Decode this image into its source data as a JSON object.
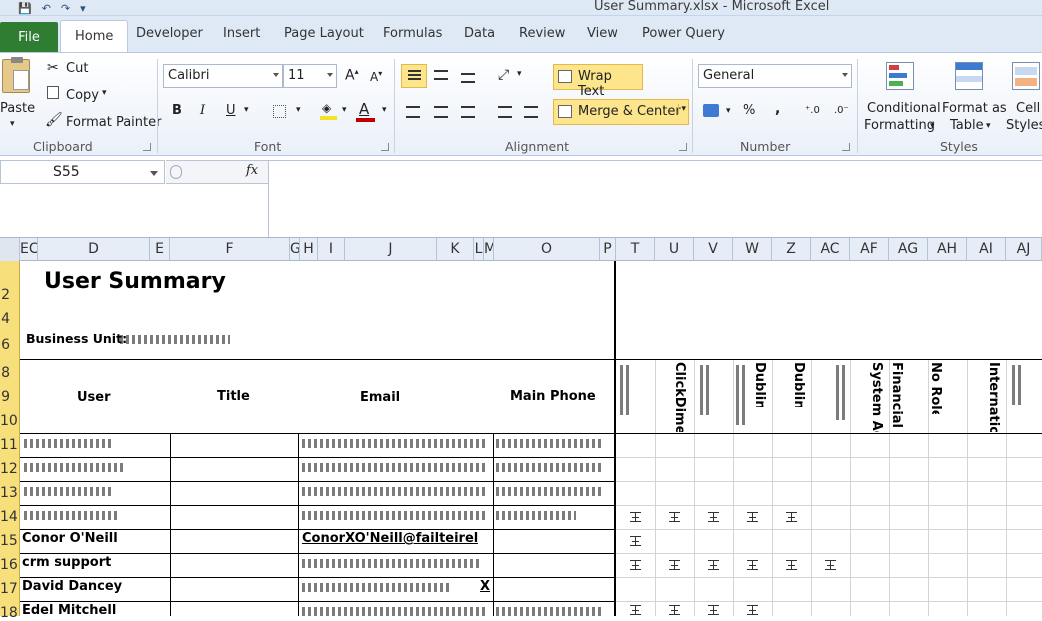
{
  "window": {
    "title": "User Summary.xlsx  -  Microsoft Excel"
  },
  "qat": {
    "save": "💾",
    "undo": "↶",
    "redo": "↷",
    "customize": "▾"
  },
  "tabs": {
    "file": "File",
    "items": [
      "Home",
      "Developer",
      "Insert",
      "Page Layout",
      "Formulas",
      "Data",
      "Review",
      "View",
      "Power Query"
    ]
  },
  "ribbon": {
    "clipboard": {
      "paste": "Paste",
      "cut": "Cut",
      "copy": "Copy",
      "format_painter": "Format Painter",
      "label": "Clipboard"
    },
    "font": {
      "name": "Calibri",
      "size": "11",
      "bold": "B",
      "italic": "I",
      "underline": "U",
      "label": "Font"
    },
    "alignment": {
      "wrap_text": "Wrap Text",
      "merge_center": "Merge & Center",
      "label": "Alignment"
    },
    "number": {
      "format": "General",
      "percent": "%",
      "comma": ",",
      "label": "Number"
    },
    "styles": {
      "conditional": "Conditional",
      "conditional2": "Formatting",
      "format_as": "Format as",
      "format_as2": "Table",
      "cell": "Cell",
      "cell2": "Styles",
      "label": "Styles"
    }
  },
  "formula_bar": {
    "name_box": "S55",
    "fx": "fx",
    "formula": ""
  },
  "columns": [
    "EC",
    "D",
    "E",
    "F",
    "G",
    "H",
    "I",
    "J",
    "K",
    "L",
    "M",
    "O",
    "P",
    "T",
    "U",
    "V",
    "W",
    "Z",
    "AC",
    "AF",
    "AG",
    "AH",
    "AI",
    "AJ"
  ],
  "rows": [
    "2",
    "4",
    "6",
    "8",
    "9",
    "10",
    "11",
    "12",
    "13",
    "14",
    "15",
    "16",
    "17",
    "18"
  ],
  "sheet": {
    "title": "User Summary",
    "business_unit_label": "Business Unit:",
    "headers": {
      "user": "User",
      "title": "Title",
      "email": "Email",
      "phone": "Main Phone"
    },
    "role_headers": [
      "ClickDimensions Core",
      "Dublin",
      "Dublin",
      "System Administrator",
      "Financial",
      "No Role",
      "International"
    ],
    "users": [
      "Conor O'Neill",
      "crm support",
      "David Dancey",
      "Edel Mitchell"
    ],
    "emails": [
      "ConorXO'Neill@failteirel",
      "ConorXO'Neill@failteirel"
    ],
    "email_tail": "X"
  }
}
